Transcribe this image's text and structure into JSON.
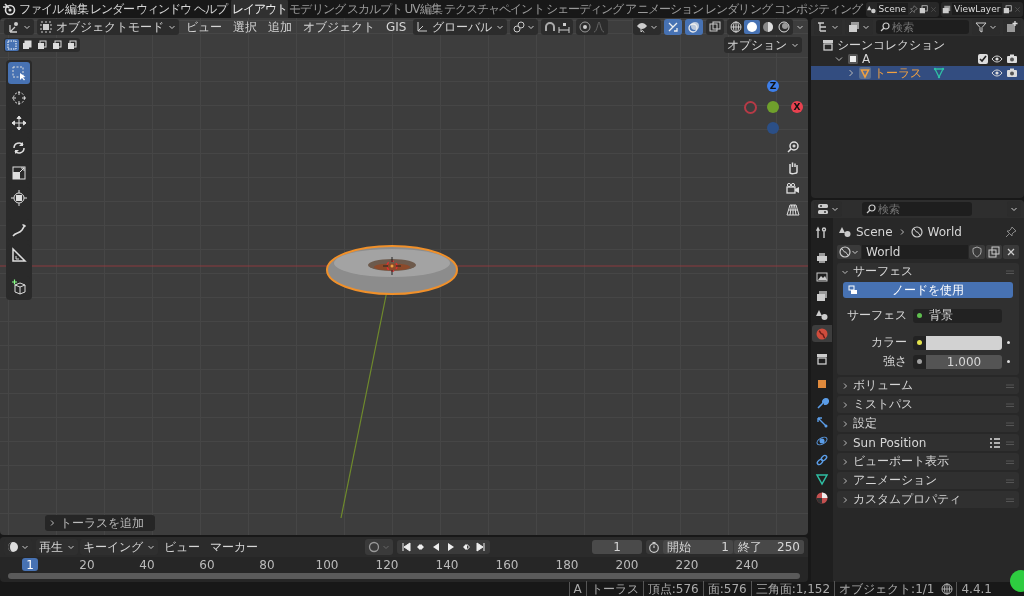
{
  "menu_bar": {
    "items": [
      "ファイル",
      "編集",
      "レンダー",
      "ウィンドウ",
      "ヘルプ"
    ]
  },
  "workspace_tabs": [
    {
      "label": "レイアウト",
      "selected": true
    },
    {
      "label": "モデリング",
      "selected": false
    },
    {
      "label": "スカルプト",
      "selected": false
    },
    {
      "label": "UV編集",
      "selected": false
    },
    {
      "label": "テクスチャペイント",
      "selected": false
    },
    {
      "label": "シェーディング",
      "selected": false
    },
    {
      "label": "アニメーション",
      "selected": false
    },
    {
      "label": "レンダリング",
      "selected": false
    },
    {
      "label": "コンポジティング",
      "selected": false
    }
  ],
  "scene_selector": {
    "value": "Scene"
  },
  "view_layer_selector": {
    "value": "ViewLayer"
  },
  "viewport": {
    "mode": "オブジェクトモード",
    "menus": [
      "ビュー",
      "選択",
      "追加",
      "オブジェクト",
      "GIS"
    ],
    "transform_orientation": "グローバル",
    "header_toggles": [
      {
        "kind": "gizmo",
        "on": true
      },
      {
        "kind": "overlay",
        "on": true
      },
      {
        "kind": "xray",
        "on": false
      }
    ],
    "shading_modes": [
      {
        "kind": "wireframe",
        "selected": false
      },
      {
        "kind": "solid",
        "selected": true
      },
      {
        "kind": "material",
        "selected": false
      },
      {
        "kind": "rendered",
        "selected": false
      }
    ],
    "selection_modes": [
      {
        "selected": true
      },
      {
        "selected": false
      },
      {
        "selected": false
      },
      {
        "selected": false
      },
      {
        "selected": false
      }
    ],
    "options_menu": "オプション",
    "tools": [
      {
        "kind": "select",
        "selected": true
      },
      {
        "kind": "cursor",
        "selected": false
      },
      {
        "kind": "move",
        "selected": false
      },
      {
        "kind": "rotate",
        "selected": false
      },
      {
        "kind": "scale",
        "selected": false
      },
      {
        "kind": "transform",
        "selected": false
      },
      {
        "kind": "annotate",
        "selected": false
      },
      {
        "kind": "measure",
        "selected": false
      },
      {
        "kind": "add-cube",
        "selected": false
      }
    ],
    "gizmo_labels": {
      "z": "Z",
      "x": "X"
    },
    "last_operator_panel": "トーラスを追加"
  },
  "outliner": {
    "search_placeholder": "検索",
    "tree": [
      {
        "kind": "scene-collection",
        "label": "シーンコレクション",
        "selected": false,
        "children": [
          {
            "kind": "collection",
            "label": "A",
            "selected": false,
            "expanded": true,
            "checked": true,
            "children": [
              {
                "kind": "object",
                "label": "トーラス",
                "selected": true,
                "expanded": false
              }
            ]
          }
        ]
      }
    ]
  },
  "properties": {
    "search_placeholder": "検索",
    "tabs": [
      {
        "kind": "tool",
        "selected": false
      },
      {
        "kind": "render",
        "selected": false
      },
      {
        "kind": "output",
        "selected": false
      },
      {
        "kind": "view-layer",
        "selected": false
      },
      {
        "kind": "scene",
        "selected": false
      },
      {
        "kind": "world",
        "selected": true
      },
      {
        "kind": "collection",
        "selected": false
      },
      {
        "kind": "object",
        "selected": false
      },
      {
        "kind": "modifier",
        "selected": false
      },
      {
        "kind": "particles",
        "selected": false
      },
      {
        "kind": "physics",
        "selected": false
      },
      {
        "kind": "constraints",
        "selected": false
      },
      {
        "kind": "data",
        "selected": false
      },
      {
        "kind": "material",
        "selected": false
      }
    ],
    "breadcrumb": [
      "Scene",
      "World"
    ],
    "world_name": "World",
    "panels": [
      {
        "title": "サーフェス",
        "expanded": true,
        "use_nodes_button": "ノードを使用",
        "fields": [
          {
            "kind": "shader",
            "label": "サーフェス",
            "value": "背景"
          },
          {
            "kind": "color",
            "label": "カラー",
            "color": "#d2d2d2"
          },
          {
            "kind": "number",
            "label": "強さ",
            "value": "1.000"
          }
        ]
      },
      {
        "title": "ボリューム",
        "expanded": false
      },
      {
        "title": "ミストパス",
        "expanded": false
      },
      {
        "title": "設定",
        "expanded": false
      },
      {
        "title": "Sun Position",
        "expanded": false,
        "list_icon": true
      },
      {
        "title": "ビューポート表示",
        "expanded": false
      },
      {
        "title": "アニメーション",
        "expanded": false
      },
      {
        "title": "カスタムプロパティ",
        "expanded": false
      }
    ]
  },
  "timeline": {
    "menus": [
      "再生",
      "キーイング",
      "ビュー",
      "マーカー"
    ],
    "current_frame": "1",
    "start_label": "開始",
    "start": "1",
    "end_label": "終了",
    "end": "250",
    "playhead": "1",
    "ruler_ticks": [
      "20",
      "40",
      "60",
      "80",
      "100",
      "120",
      "140",
      "160",
      "180",
      "200",
      "220",
      "240"
    ]
  },
  "status_bar": {
    "items": [
      "A",
      "トーラス",
      "頂点:576",
      "面:576",
      "三角面:1,152",
      "オブジェクト:1/1"
    ],
    "version": "4.4.1"
  }
}
